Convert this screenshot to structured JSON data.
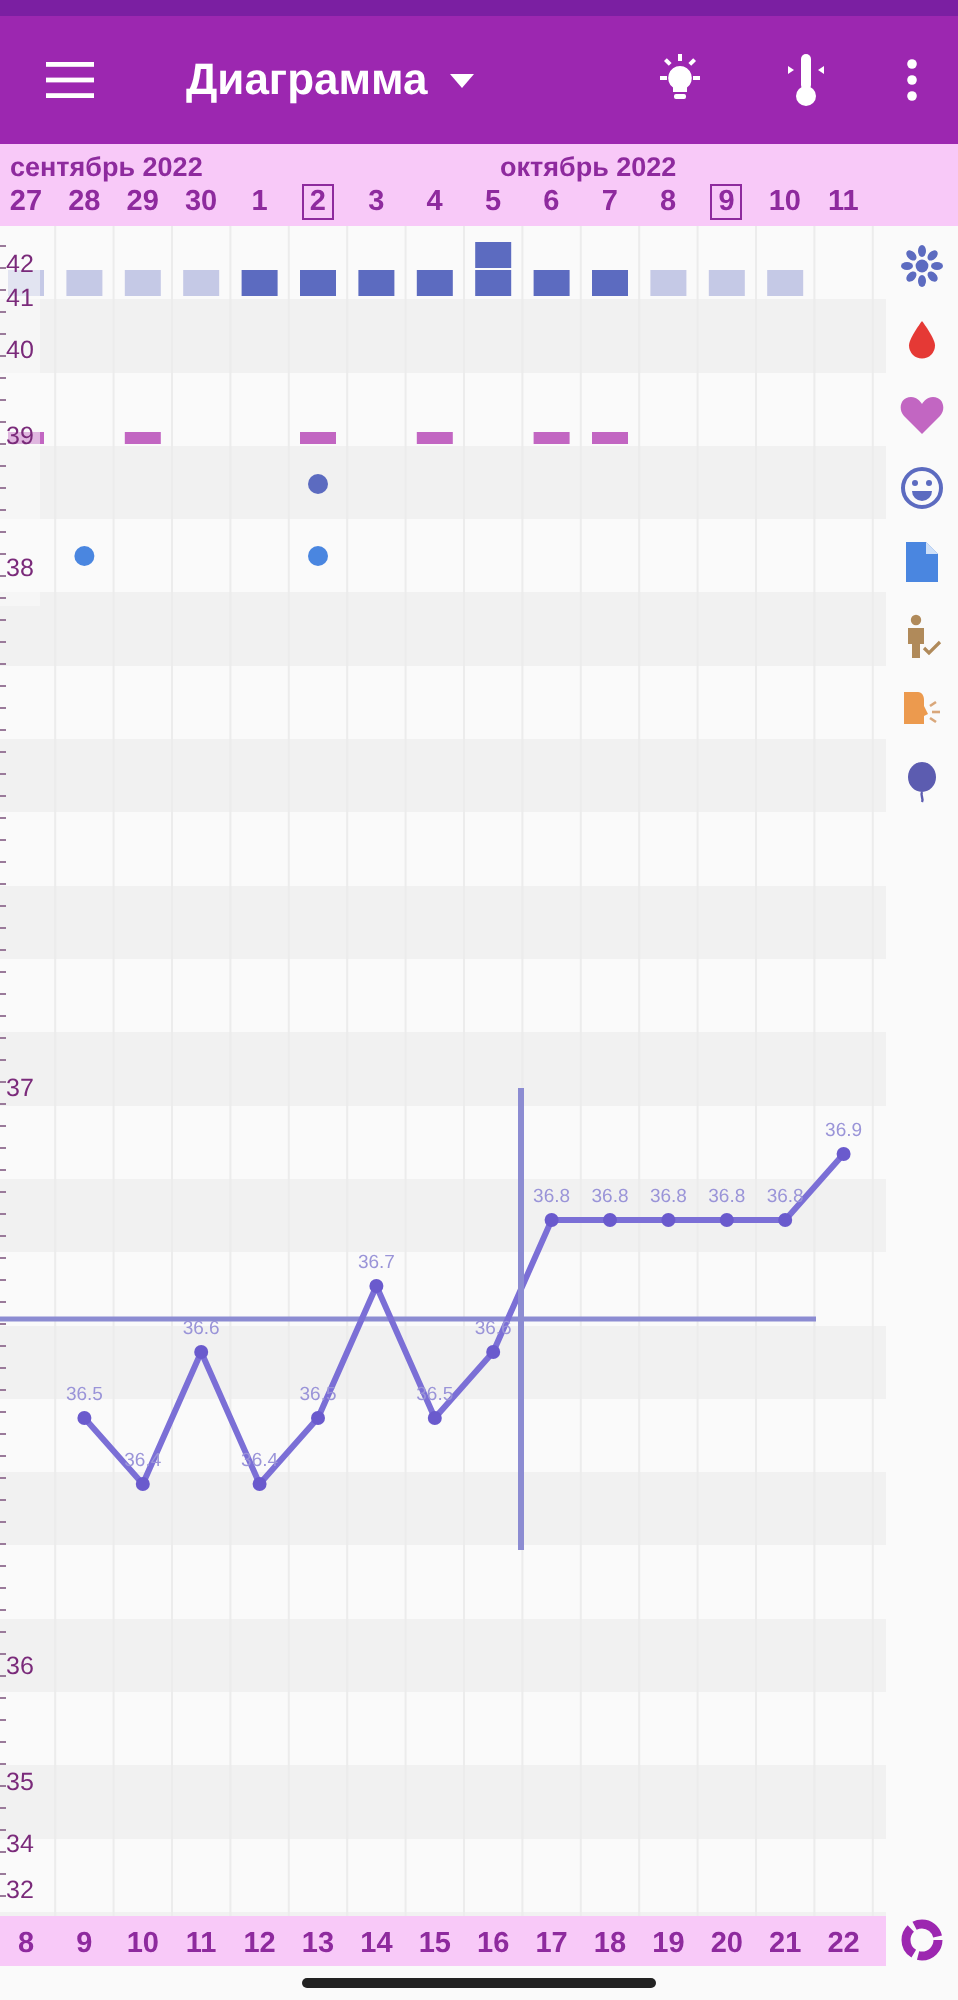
{
  "app_bar": {
    "title": "Диаграмма"
  },
  "months": [
    {
      "label": "сентябрь 2022"
    },
    {
      "label": "октябрь 2022"
    }
  ],
  "days": [
    {
      "date": "27",
      "marked": false,
      "kind": "light",
      "intercourse": true,
      "mood": false,
      "note": false
    },
    {
      "date": "28",
      "marked": false,
      "kind": "light",
      "intercourse": false,
      "mood": false,
      "note": true
    },
    {
      "date": "29",
      "marked": false,
      "kind": "light",
      "intercourse": true,
      "mood": false,
      "note": false
    },
    {
      "date": "30",
      "marked": false,
      "kind": "light",
      "intercourse": false,
      "mood": false,
      "note": false
    },
    {
      "date": "1",
      "marked": false,
      "kind": "dark",
      "intercourse": false,
      "mood": false,
      "note": false
    },
    {
      "date": "2",
      "marked": true,
      "kind": "dark",
      "intercourse": true,
      "mood": true,
      "note": true
    },
    {
      "date": "3",
      "marked": false,
      "kind": "dark",
      "intercourse": false,
      "mood": false,
      "note": false
    },
    {
      "date": "4",
      "marked": false,
      "kind": "dark",
      "intercourse": true,
      "mood": false,
      "note": false
    },
    {
      "date": "5",
      "marked": false,
      "kind": "double",
      "intercourse": false,
      "mood": false,
      "note": false
    },
    {
      "date": "6",
      "marked": false,
      "kind": "dark",
      "intercourse": true,
      "mood": false,
      "note": false
    },
    {
      "date": "7",
      "marked": false,
      "kind": "dark",
      "intercourse": true,
      "mood": false,
      "note": false
    },
    {
      "date": "8",
      "marked": false,
      "kind": "light",
      "intercourse": false,
      "mood": false,
      "note": false
    },
    {
      "date": "9",
      "marked": true,
      "kind": "light",
      "intercourse": false,
      "mood": false,
      "note": false
    },
    {
      "date": "10",
      "marked": false,
      "kind": "light",
      "intercourse": false,
      "mood": false,
      "note": false
    },
    {
      "date": "11",
      "marked": false,
      "kind": "none",
      "intercourse": false,
      "mood": false,
      "note": false
    }
  ],
  "y_axis_labels": [
    "42",
    "41",
    "40",
    "39",
    "38",
    "37",
    "36",
    "35",
    "34",
    "32"
  ],
  "chart": {
    "chart_data": {
      "type": "line",
      "categories": [
        "8",
        "9",
        "10",
        "11",
        "12",
        "13",
        "14",
        "15",
        "16",
        "17",
        "18",
        "19",
        "20",
        "21",
        "22"
      ],
      "series": [
        {
          "color": "#7b6fd6",
          "marker": "circle",
          "values": [
            null,
            36.5,
            36.4,
            36.6,
            36.4,
            36.5,
            36.7,
            36.5,
            36.6,
            36.8,
            36.8,
            36.8,
            36.8,
            36.8,
            36.9
          ]
        }
      ],
      "ref_lines": [
        {
          "axis": "y",
          "value": 36.65
        }
      ],
      "data_labels": true
    }
  }
}
